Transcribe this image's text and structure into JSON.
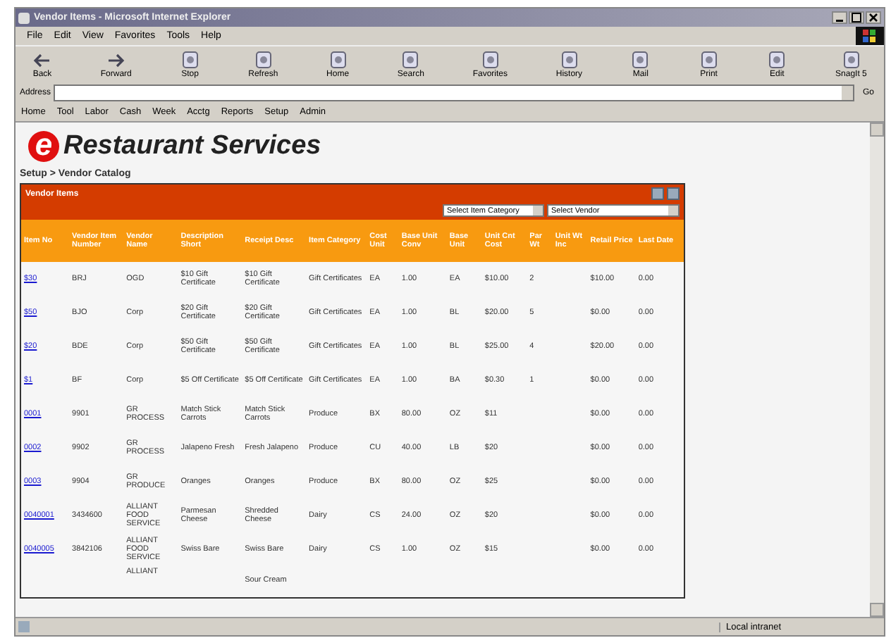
{
  "window": {
    "title": "Vendor Items - Microsoft Internet Explorer"
  },
  "menu": [
    "File",
    "Edit",
    "View",
    "Favorites",
    "Tools",
    "Help"
  ],
  "toolbar": [
    "Back",
    "Forward",
    "Stop",
    "Refresh",
    "Home",
    "Search",
    "Favorites",
    "History",
    "Mail",
    "Print",
    "Edit",
    "SnagIt 5"
  ],
  "address": {
    "label": "Address",
    "go": "Go"
  },
  "links": [
    "Home",
    "Tool",
    "Labor",
    "Cash",
    "Week",
    "Acctg",
    "Reports",
    "Setup",
    "Admin"
  ],
  "logo": {
    "letter": "e",
    "text": "Restaurant Services"
  },
  "breadcrumb": "Setup > Vendor Catalog",
  "panel": {
    "title": "Vendor Items",
    "filters": [
      "Select Item Category",
      "Select Vendor"
    ]
  },
  "table": {
    "columns": [
      "Item No",
      "Vendor Item Number",
      "Vendor Name",
      "Description Short",
      "Receipt Desc",
      "Item Category",
      "Cost Unit",
      "Base Unit Conv",
      "Base Unit",
      "Unit Cnt Cost",
      "Par Wt",
      "Unit Wt Inc",
      "Retail Price",
      "Last Date"
    ],
    "rows": [
      {
        "cells": [
          "$30",
          "BRJ",
          "OGD",
          "$10 Gift Certificate",
          "$10 Gift Certificate",
          "Gift Certificates",
          "EA",
          "1.00",
          "EA",
          "$10.00",
          "2",
          null,
          "$10.00",
          "0.00"
        ]
      },
      {
        "cells": [
          "$50",
          "BJO",
          "Corp",
          "$20 Gift Certificate",
          "$20 Gift Certificate",
          "Gift Certificates",
          "EA",
          "1.00",
          "BL",
          "$20.00",
          "5",
          null,
          "$0.00",
          "0.00"
        ]
      },
      {
        "cells": [
          "$20",
          "BDE",
          "Corp",
          "$50 Gift Certificate",
          "$50 Gift Certificate",
          "Gift Certificates",
          "EA",
          "1.00",
          "BL",
          "$25.00",
          "4",
          null,
          "$20.00",
          "0.00"
        ]
      },
      {
        "cells": [
          "$1",
          "BF",
          "Corp",
          "$5 Off Certificate",
          "$5 Off Certificate",
          "Gift Certificates",
          "EA",
          "1.00",
          "BA",
          "$0.30",
          "1",
          null,
          "$0.00",
          "0.00"
        ]
      },
      {
        "cells": [
          "0001",
          "9901",
          "GR PROCESS",
          "Match Stick Carrots",
          "Match Stick Carrots",
          "Produce",
          "BX",
          "80.00",
          "OZ",
          "$11",
          null,
          null,
          "$0.00",
          "0.00"
        ]
      },
      {
        "cells": [
          "0002",
          "9902",
          "GR PROCESS",
          "Jalapeno Fresh",
          "Fresh Jalapeno",
          "Produce",
          "CU",
          "40.00",
          "LB",
          "$20",
          null,
          null,
          "$0.00",
          "0.00"
        ]
      },
      {
        "cells": [
          "0003",
          "9904",
          "GR PRODUCE",
          "Oranges",
          "Oranges",
          "Produce",
          "BX",
          "80.00",
          "OZ",
          "$25",
          null,
          null,
          "$0.00",
          "0.00"
        ]
      },
      {
        "cells": [
          "0040001",
          "3434600",
          "ALLIANT FOOD SERVICE",
          "Parmesan Cheese",
          "Shredded Cheese",
          "Dairy",
          "CS",
          "24.00",
          "OZ",
          "$20",
          null,
          null,
          "$0.00",
          "0.00"
        ]
      },
      {
        "cells": [
          "0040005",
          "3842106",
          "ALLIANT FOOD SERVICE",
          "Swiss Bare",
          "Swiss Bare",
          "Dairy",
          "CS",
          "1.00",
          "OZ",
          "$15",
          null,
          null,
          "$0.00",
          "0.00"
        ]
      }
    ],
    "partial_row": {
      "vendor": "ALLIANT",
      "receipt": "Sour Cream"
    }
  },
  "status_bar": {
    "zone": "Local intranet"
  }
}
